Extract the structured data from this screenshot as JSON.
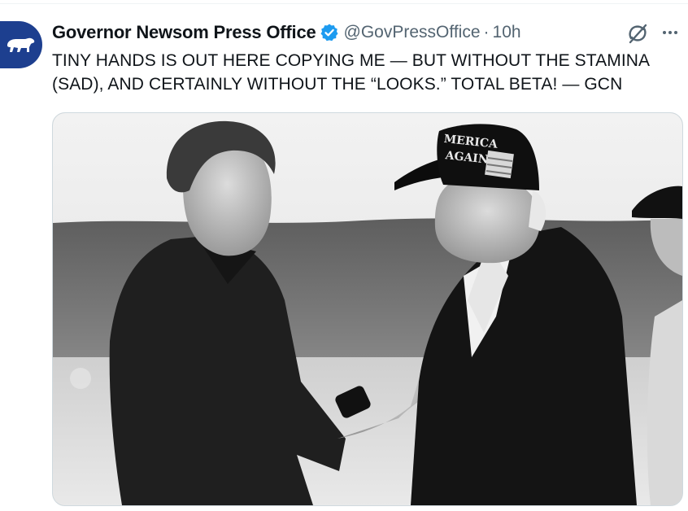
{
  "account": {
    "name": "Governor Newsom Press Office",
    "handle": "@GovPressOffice",
    "separator": "·",
    "time": "10h"
  },
  "tweet": {
    "lines": [
      "TINY HANDS IS OUT HERE COPYING ME — BUT WITHOUT THE STAMINA",
      "(SAD), AND CERTAINLY WITHOUT THE “LOOKS.” TOTAL BETA! — GCN"
    ]
  },
  "media": {
    "hat_text_line1": "MERICA",
    "hat_text_line2": "AGAIN"
  },
  "icons": {
    "avatar": "california-bear-logo",
    "verified": "verified-badge-icon",
    "grok": "grok-icon",
    "more": "more-options-icon"
  },
  "colors": {
    "avatar_bg": "#1d3f8f",
    "verified_blue": "#1d9bf0",
    "secondary_text": "#536471"
  }
}
